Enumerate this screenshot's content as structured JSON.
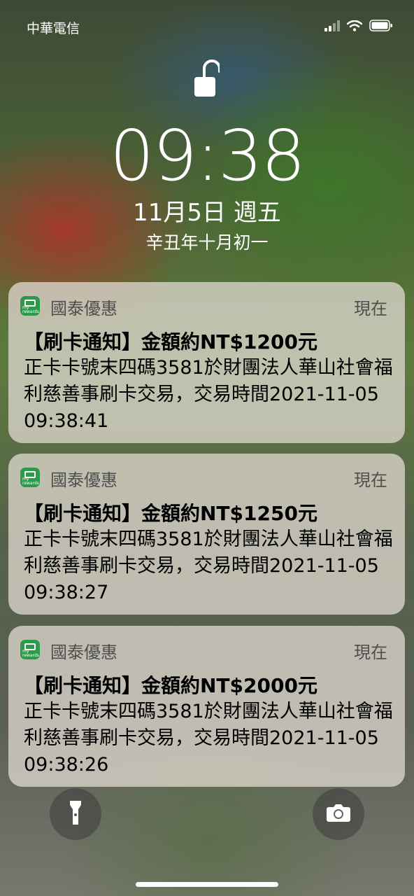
{
  "status_bar": {
    "carrier": "中華電信"
  },
  "lock_screen": {
    "time": "09:38",
    "date": "11月5日 週五",
    "lunar_date": "辛丑年十月初一"
  },
  "notifications": [
    {
      "app_name": "國泰優惠",
      "app_icon_text": "my rewards",
      "when": "現在",
      "title": "【刷卡通知】金額約NT$1200元",
      "body": "正卡卡號末四碼3581於財團法人華山社會福利慈善事刷卡交易，交易時間2021-11-05 09:38:41"
    },
    {
      "app_name": "國泰優惠",
      "app_icon_text": "my rewards",
      "when": "現在",
      "title": "【刷卡通知】金額約NT$1250元",
      "body": "正卡卡號末四碼3581於財團法人華山社會福利慈善事刷卡交易，交易時間2021-11-05 09:38:27"
    },
    {
      "app_name": "國泰優惠",
      "app_icon_text": "my rewards",
      "when": "現在",
      "title": "【刷卡通知】金額約NT$2000元",
      "body": "正卡卡號末四碼3581於財團法人華山社會福利慈善事刷卡交易，交易時間2021-11-05 09:38:26"
    }
  ],
  "icons": {
    "lock": "unlocked-padlock-icon",
    "flashlight": "flashlight-icon",
    "camera": "camera-icon",
    "signal": "signal-bars-icon",
    "wifi": "wifi-icon",
    "battery": "battery-icon"
  },
  "colors": {
    "app_icon": "#2c9a4b"
  }
}
